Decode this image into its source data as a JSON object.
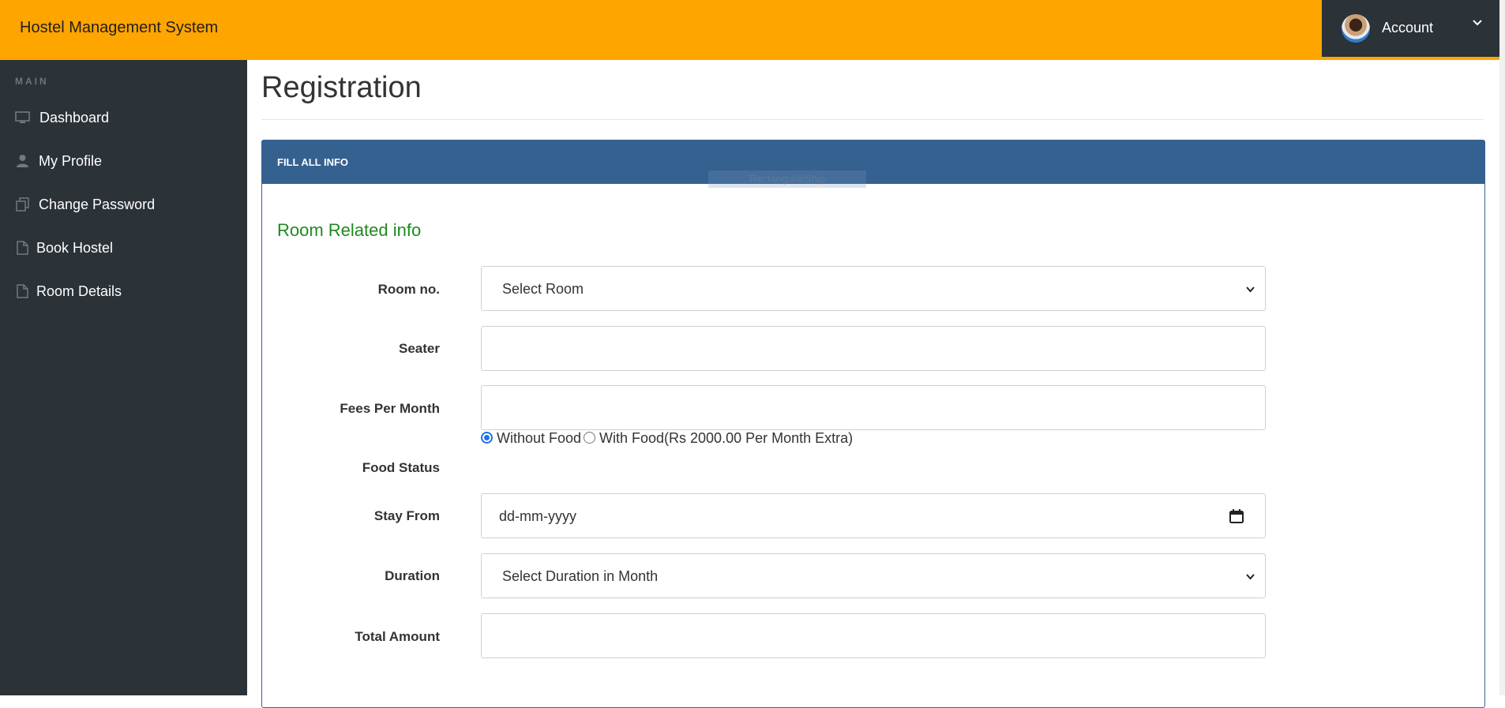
{
  "header": {
    "brand": "Hostel Management System",
    "account_label": "Account"
  },
  "sidebar": {
    "section": "MAIN",
    "items": [
      {
        "label": "Dashboard",
        "icon": "monitor-icon"
      },
      {
        "label": "My Profile",
        "icon": "user-icon"
      },
      {
        "label": "Change Password",
        "icon": "files-icon"
      },
      {
        "label": "Book Hostel",
        "icon": "file-icon"
      },
      {
        "label": "Room Details",
        "icon": "file-icon"
      }
    ]
  },
  "page": {
    "title": "Registration",
    "panel_heading": "FILL ALL INFO",
    "ghost_text": "RectangularSnip",
    "section_title": "Room Related info"
  },
  "form": {
    "room_no": {
      "label": "Room no.",
      "value": "Select Room"
    },
    "seater": {
      "label": "Seater",
      "value": ""
    },
    "fees": {
      "label": "Fees Per Month",
      "value": ""
    },
    "food": {
      "label": "Food Status",
      "option1": "Without Food",
      "option2": "With Food(Rs 2000.00 Per Month Extra)",
      "selected": "Without Food"
    },
    "stay_from": {
      "label": "Stay From",
      "placeholder": "dd-mm-yyyy"
    },
    "duration": {
      "label": "Duration",
      "value": "Select Duration in Month"
    },
    "total": {
      "label": "Total Amount",
      "value": ""
    }
  },
  "colors": {
    "topbar": "#ffa500",
    "sidebar": "#2b3238",
    "panel_header": "#356190",
    "section_title": "#1e8a1e",
    "radio_accent": "#1a73e8"
  }
}
